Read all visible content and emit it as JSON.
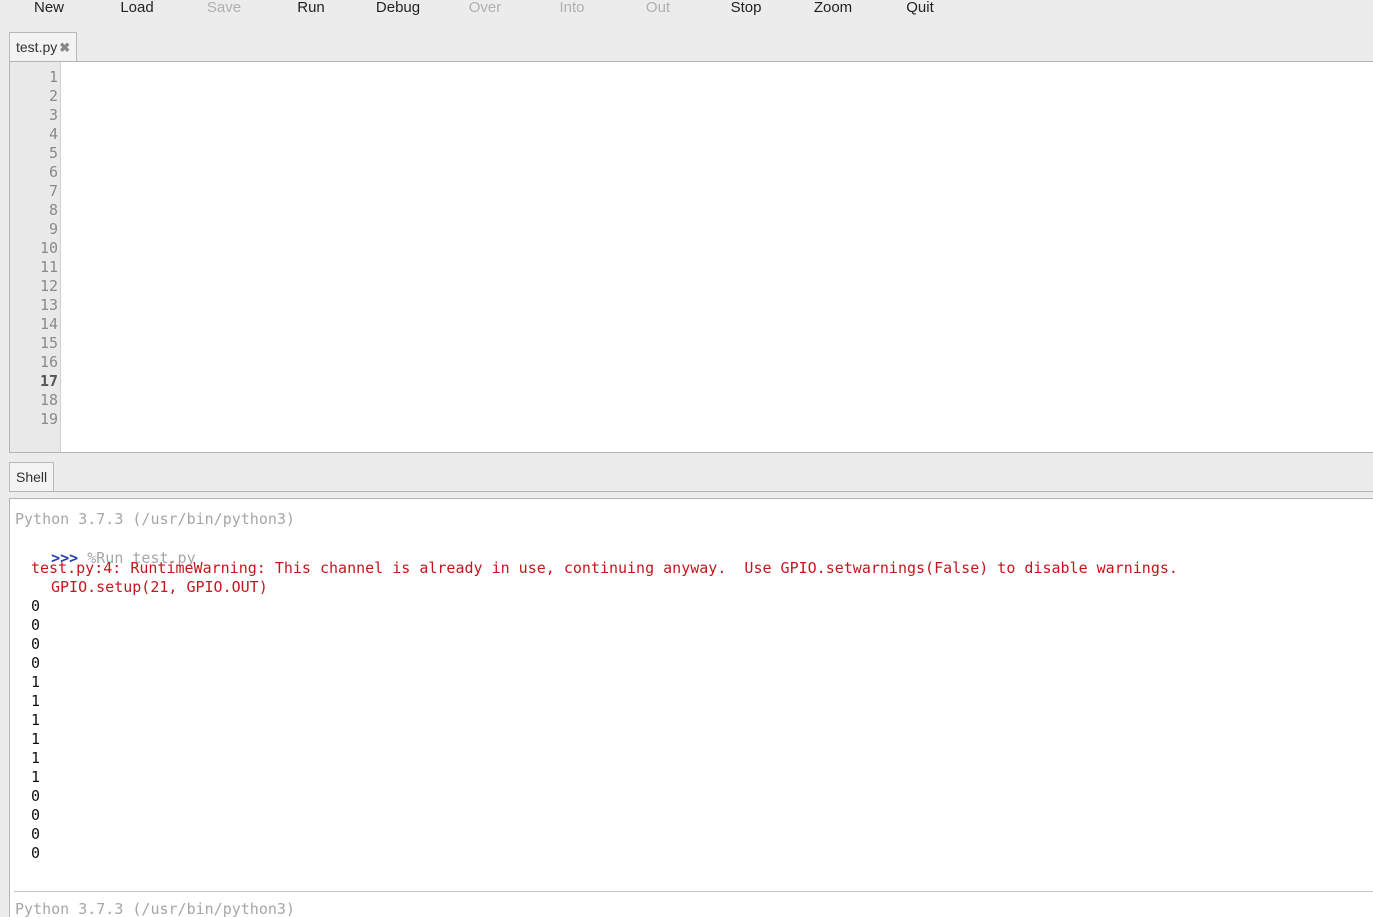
{
  "toolbar": {
    "buttons": [
      {
        "label": "New",
        "enabled": true
      },
      {
        "label": "Load",
        "enabled": true
      },
      {
        "label": "Save",
        "enabled": false
      },
      {
        "label": "Run",
        "enabled": true
      },
      {
        "label": "Debug",
        "enabled": true
      },
      {
        "label": "Over",
        "enabled": false
      },
      {
        "label": "Into",
        "enabled": false
      },
      {
        "label": "Out",
        "enabled": false
      },
      {
        "label": "Stop",
        "enabled": true
      },
      {
        "label": "Zoom",
        "enabled": true
      },
      {
        "label": "Quit",
        "enabled": true
      }
    ]
  },
  "editor": {
    "tab_label": "test.py",
    "close_glyph": "✖",
    "current_line": 17,
    "line_numbers": [
      "1",
      "2",
      "3",
      "4",
      "5",
      "6",
      "7",
      "8",
      "9",
      "10",
      "11",
      "12",
      "13",
      "14",
      "15",
      "16",
      "17",
      "18",
      "19"
    ]
  },
  "shell": {
    "tab_label": "Shell",
    "header": "Python 3.7.3 (/usr/bin/python3)",
    "prompt": ">>>",
    "command": "%Run test.py",
    "warning_line1": "test.py:4: RuntimeWarning: This channel is already in use, continuing anyway.  Use GPIO.setwarnings(False) to disable warnings.",
    "warning_line2": "GPIO.setup(21, GPIO.OUT)",
    "outputs": [
      "0",
      "0",
      "0",
      "0",
      "1",
      "1",
      "1",
      "1",
      "1",
      "1",
      "0",
      "0",
      "0",
      "0"
    ],
    "footer": "Python 3.7.3 (/usr/bin/python3)"
  },
  "colors": {
    "keyword": "#7a0a5e",
    "number": "#c4610a",
    "comment": "#a8a8a8",
    "error": "#c4161c",
    "prompt": "#1f3fb3"
  }
}
